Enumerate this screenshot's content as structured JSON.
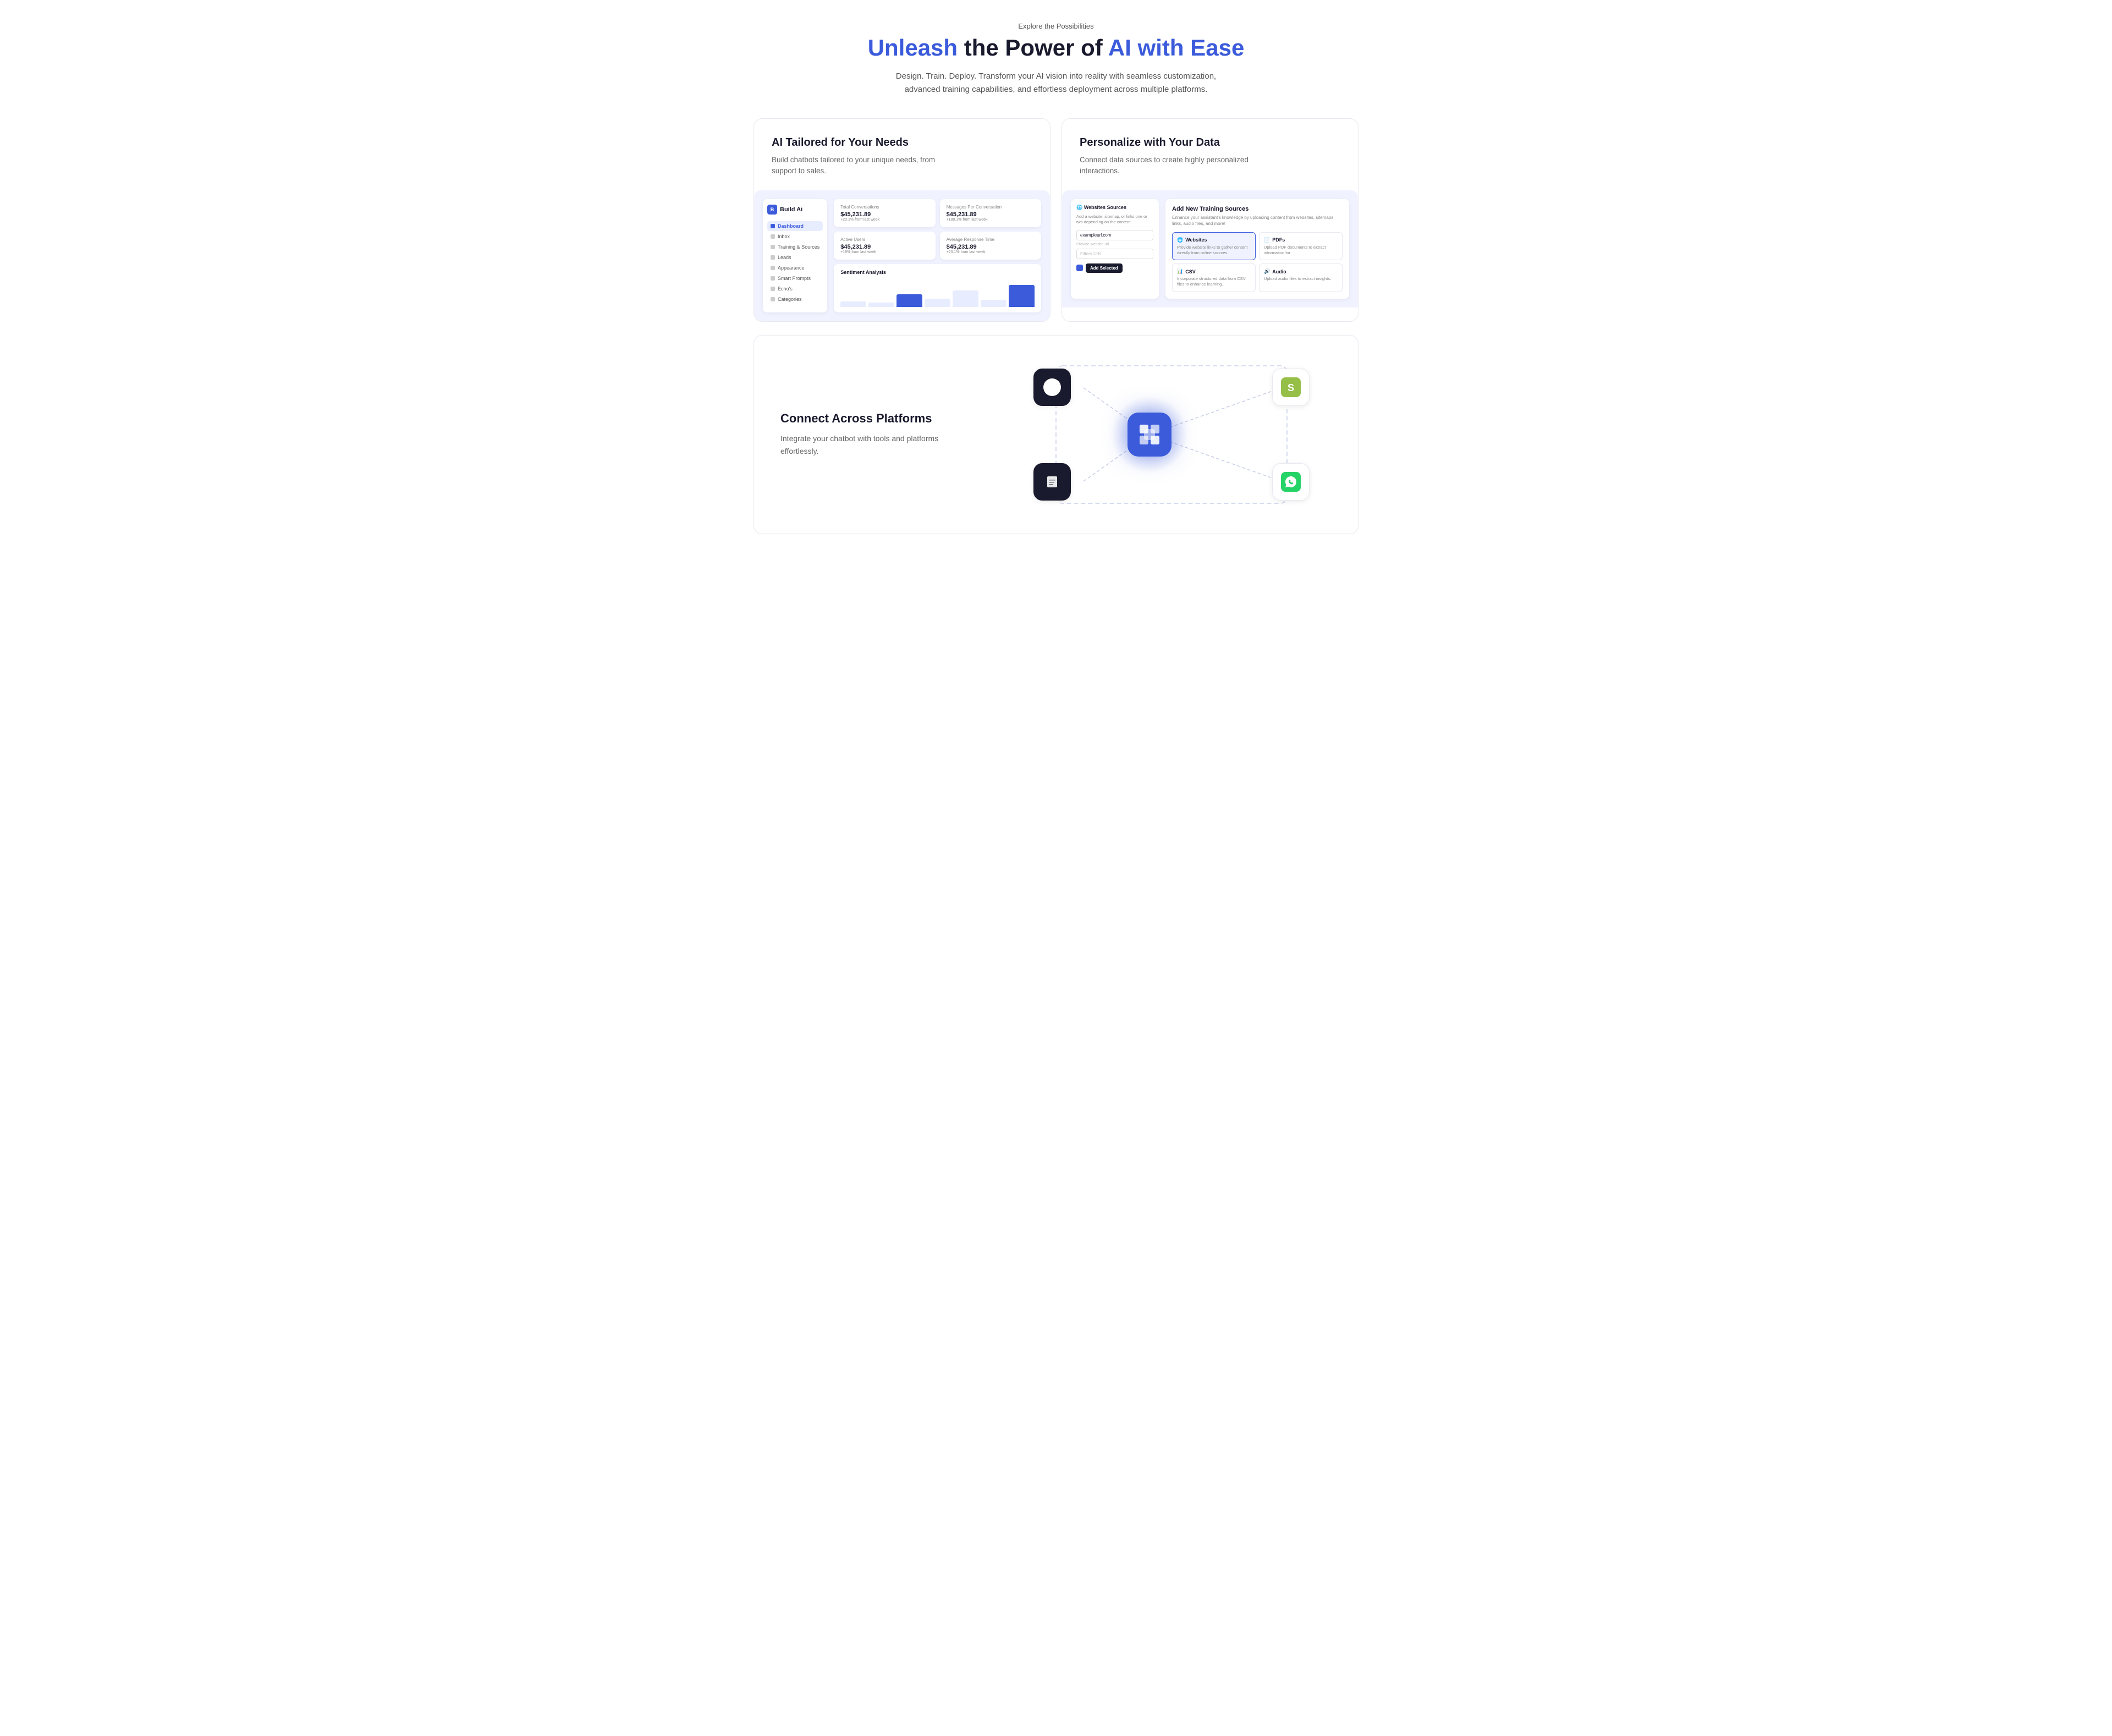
{
  "header": {
    "explore_label": "Explore the Possibilities",
    "title_part1": "Unleash",
    "title_part2": " the Power of ",
    "title_part3": "AI with Ease",
    "subtitle": "Design. Train. Deploy. Transform your AI vision into reality with seamless customization, advanced training capabilities, and effortless deployment across multiple platforms."
  },
  "card1": {
    "title": "AI Tailored for Your Needs",
    "desc": "Build chatbots tailored to your unique needs, from support to sales.",
    "sidebar": {
      "logo": "Build Ai",
      "nav_items": [
        {
          "label": "Dashboard",
          "active": true
        },
        {
          "label": "Inbox",
          "active": false
        },
        {
          "label": "Training & Sources",
          "active": false
        },
        {
          "label": "Leads",
          "active": false
        },
        {
          "label": "Appearance",
          "active": false
        },
        {
          "label": "Smart Prompts",
          "active": false
        },
        {
          "label": "Echo's",
          "active": false
        },
        {
          "label": "Categories",
          "active": false
        }
      ]
    },
    "stats": [
      {
        "label": "Total Conversations",
        "value": "$45,231.89",
        "change": "+20.1% from last week"
      },
      {
        "label": "Messages Per Conversation",
        "value": "$45,231.89",
        "change": "+180.1% from last week"
      },
      {
        "label": "Active Users",
        "value": "$45,231.89",
        "change": "+19% from last week"
      },
      {
        "label": "Average Response Time",
        "value": "$45,231.89",
        "change": "+20.1% from last week"
      }
    ],
    "chart_title": "Sentiment Analysis",
    "bars": [
      20,
      15,
      45,
      30,
      60,
      25,
      80
    ]
  },
  "card2": {
    "title": "Personalize with Your Data",
    "desc": "Connect data sources to create highly personalized interactions.",
    "panel_title": "Add New Training Sources",
    "panel_desc": "Enhance your assistant's knowledge by uploading content from websites, sitemaps, links, audio files, and more!",
    "website_section": {
      "title": "Websites Sources",
      "desc": "Add a website, sitemap, or links one or two depending on the content",
      "url_placeholder": "exampleurl.com",
      "filter_placeholder": "Filters Urls...",
      "add_btn": "Add Selected"
    },
    "source_cards": [
      {
        "title": "Websites",
        "desc": "Provide website links to gather content directly from online sources.",
        "icon": "globe"
      },
      {
        "title": "PDFs",
        "desc": "Upload PDF documents to extract information for",
        "icon": "pdf"
      },
      {
        "title": "CSV",
        "desc": "Incorporate structured data from CSV files to enhance learning.",
        "icon": "csv"
      },
      {
        "title": "Audio",
        "desc": "Upload audio files to extract insights.",
        "icon": "audio"
      }
    ]
  },
  "card3": {
    "title": "Connect Across Platforms",
    "desc": "Integrate your chatbot with tools and platforms effortlessly.",
    "platforms": [
      "WordPress",
      "Shopify",
      "Document",
      "WhatsApp"
    ]
  }
}
